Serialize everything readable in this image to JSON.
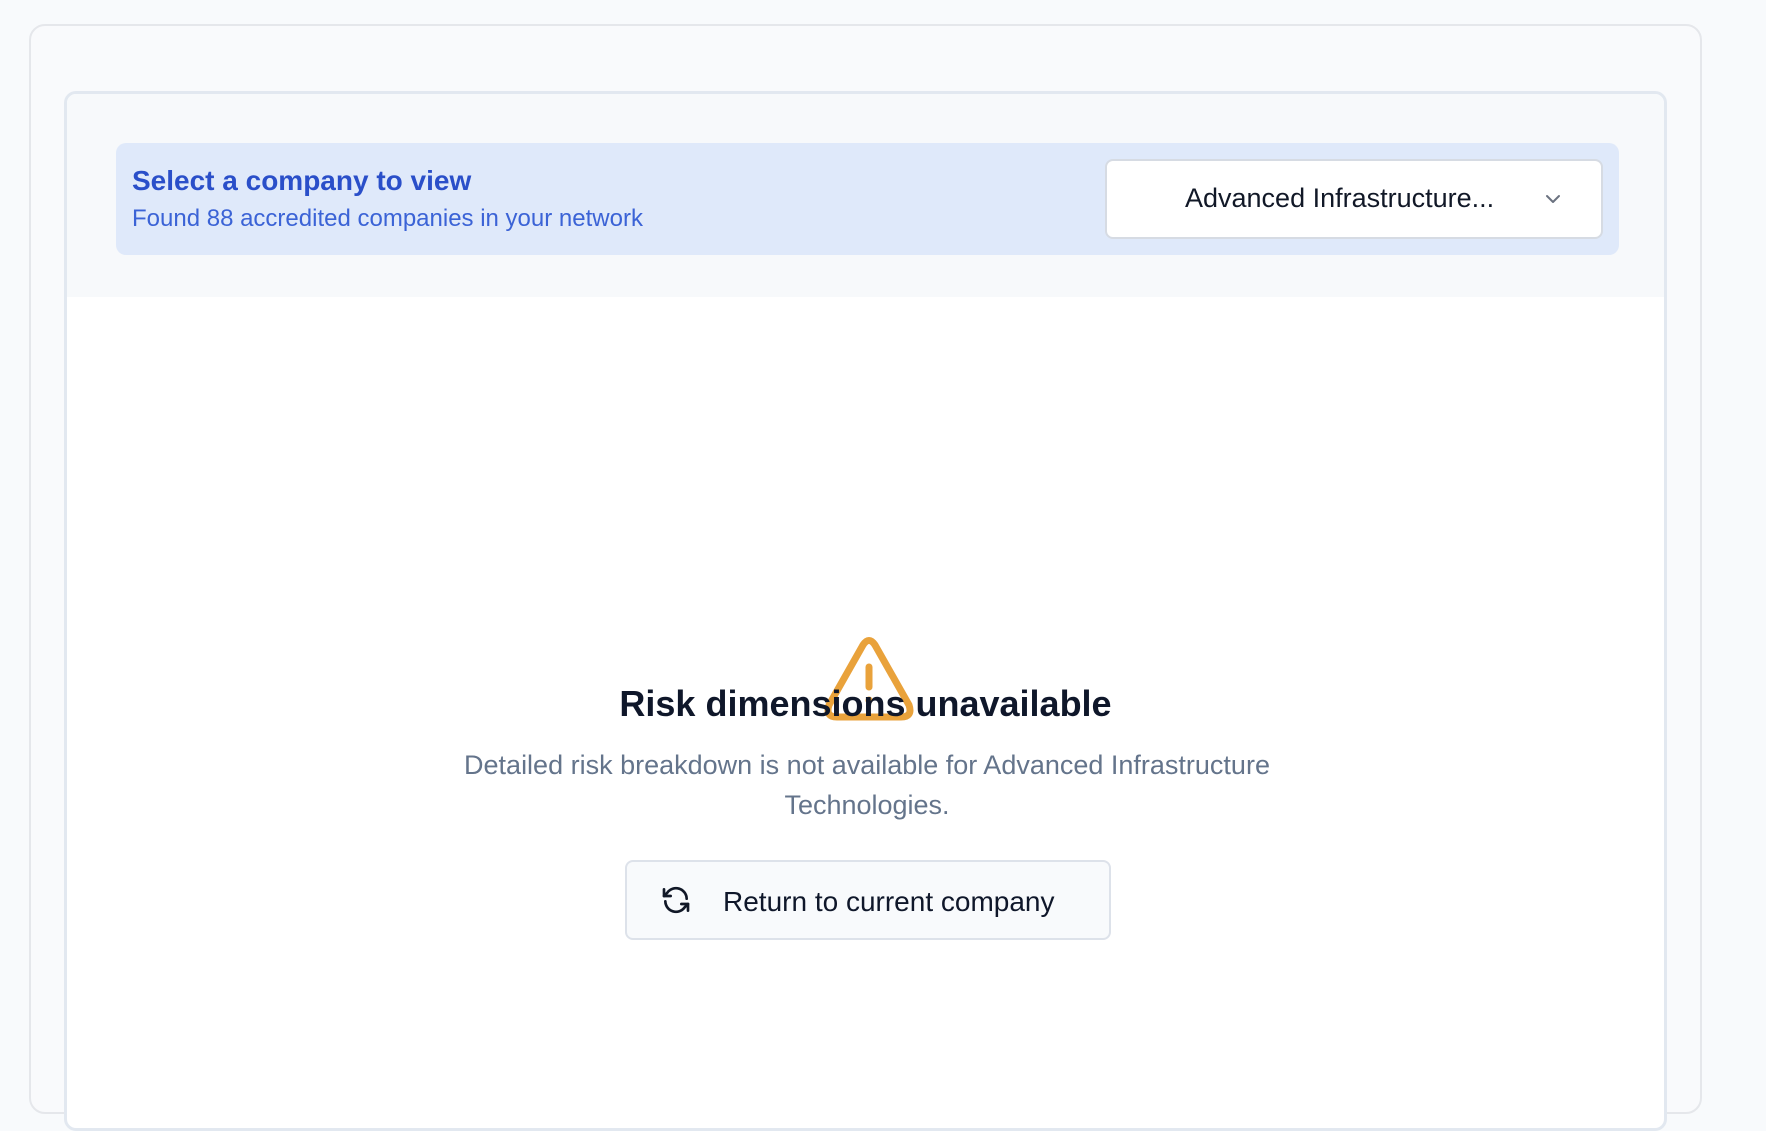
{
  "selector": {
    "title": "Select a company to view",
    "subtitle": "Found 88 accredited companies in your network",
    "selected_company": "Advanced Infrastructure...",
    "chevron_icon": "chevron-down-icon"
  },
  "empty_state": {
    "icon": "warning-triangle-icon",
    "icon_color": "#e9a23b",
    "title": "Risk dimensions unavailable",
    "description": "Detailed risk breakdown is not available for Advanced Infrastructure Technologies.",
    "button_icon": "refresh-icon",
    "button_label": "Return to current company"
  },
  "colors": {
    "accent": "#2a4fc9",
    "banner_bg": "#dfe9fa",
    "muted_text": "#64748b"
  }
}
